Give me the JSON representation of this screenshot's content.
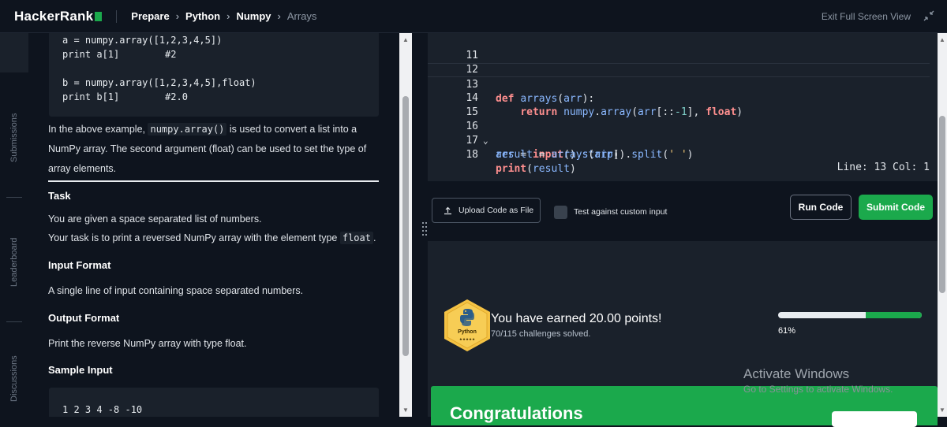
{
  "header": {
    "logo_text": "HackerRank",
    "breadcrumb": [
      "Prepare",
      "Python",
      "Numpy"
    ],
    "breadcrumb_current": "Arrays",
    "exit_fullscreen": "Exit Full Screen View"
  },
  "sidebar_tabs": [
    "Submissions",
    "Leaderboard",
    "Discussions"
  ],
  "problem": {
    "example_code": "a = numpy.array([1,2,3,4,5])\nprint a[1]        #2\n\nb = numpy.array([1,2,3,4,5],float)\nprint b[1]        #2.0",
    "explain_before": "In the above example, ",
    "explain_code": "numpy.array()",
    "explain_after": " is used to convert a list into a NumPy array. The second argument (float) can be used to set the type of array elements.",
    "task_heading": "Task",
    "task_line1": "You are given a space separated list of numbers.",
    "task_line2_before": "Your task is to print a reversed NumPy array with the element type ",
    "task_line2_code": "float",
    "task_line2_after": ".",
    "input_heading": "Input Format",
    "input_text": "A single line of input containing space separated numbers.",
    "output_heading": "Output Format",
    "output_text": "Print the reverse NumPy array with type float.",
    "sample_heading": "Sample Input",
    "sample_input": "1 2 3 4 -8 -10"
  },
  "editor": {
    "line_numbers": [
      "11",
      "12",
      "13",
      "14",
      "15",
      "16",
      "17",
      "18"
    ],
    "status": "Line: 13 Col: 1"
  },
  "actions": {
    "upload_label": "Upload Code as File",
    "custom_input_label": "Test against custom input",
    "run_label": "Run Code",
    "submit_label": "Submit Code"
  },
  "result": {
    "badge_label": "Python",
    "earned_text": "You have earned 20.00 points!",
    "solved_text": "70/115 challenges solved.",
    "progress_percent_label": "61%",
    "progress_fraction": 0.61,
    "congrats_title": "Congratulations"
  },
  "watermark": {
    "title": "Activate Windows",
    "subtitle": "Go to Settings to activate Windows."
  },
  "colors": {
    "accent_green": "#1ba94c",
    "background": "#0e141e",
    "panel": "#1a212b"
  }
}
